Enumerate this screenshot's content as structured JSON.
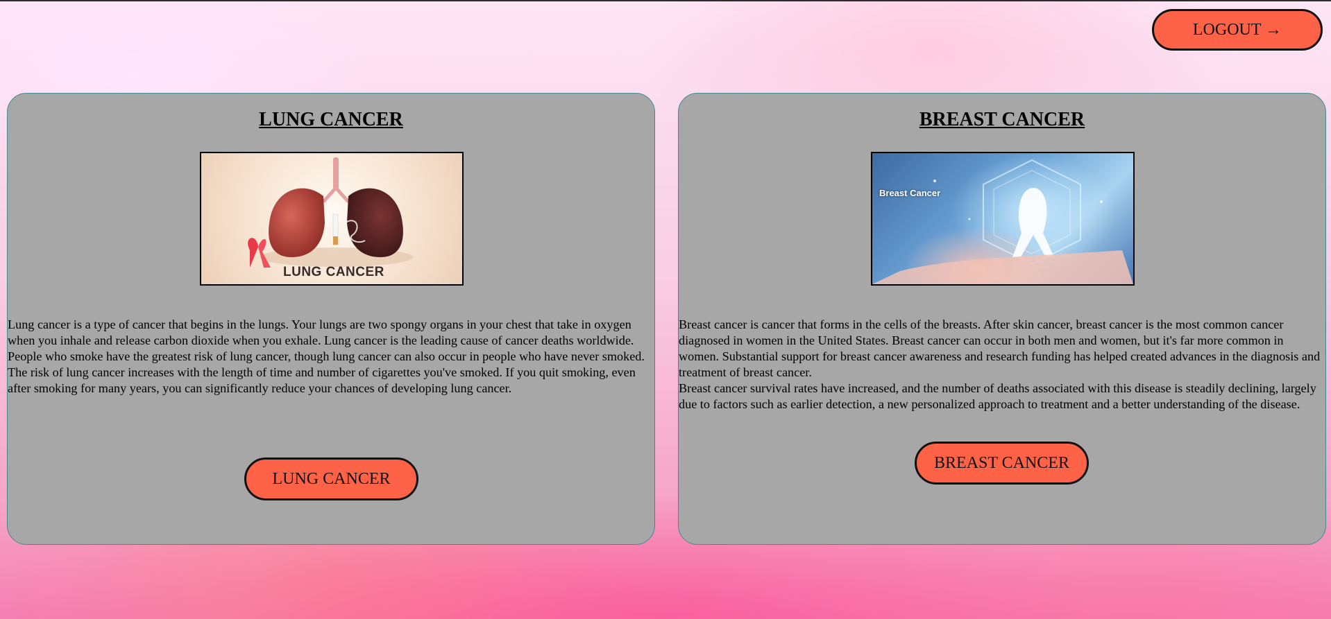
{
  "header": {
    "logout_label": "LOGOUT →"
  },
  "cards": [
    {
      "title": "LUNG CANCER",
      "image_caption": "LUNG CANCER",
      "paragraphs": [
        "Lung cancer is a type of cancer that begins in the lungs. Your lungs are two spongy organs in your chest that take in oxygen when you inhale and release carbon dioxide when you exhale. Lung cancer is the leading cause of cancer deaths worldwide. People who smoke have the greatest risk of lung cancer, though lung cancer can also occur in people who have never smoked.",
        "The risk of lung cancer increases with the length of time and number of cigarettes you've smoked. If you quit smoking, even after smoking for many years, you can significantly reduce your chances of developing lung cancer."
      ],
      "button_label": "LUNG CANCER"
    },
    {
      "title": "BREAST CANCER",
      "image_caption": "Breast Cancer",
      "paragraphs": [
        "Breast cancer is cancer that forms in the cells of the breasts. After skin cancer, breast cancer is the most common cancer diagnosed in women in the United States. Breast cancer can occur in both men and women, but it's far more common in women. Substantial support for breast cancer awareness and research funding has helped created advances in the diagnosis and treatment of breast cancer.",
        "Breast cancer survival rates have increased, and the number of deaths associated with this disease is steadily declining, largely due to factors such as earlier detection, a new personalized approach to treatment and a better understanding of the disease."
      ],
      "button_label": "BREAST CANCER"
    }
  ],
  "colors": {
    "button": "#ff6347",
    "card": "#a7a7a7",
    "card_border": "#3f8a8d"
  },
  "icons": {
    "lung_image": "lungs-with-ribbon-illustration",
    "breast_image": "hand-holding-ribbon-illustration",
    "logout_arrow": "right-arrow-icon"
  }
}
